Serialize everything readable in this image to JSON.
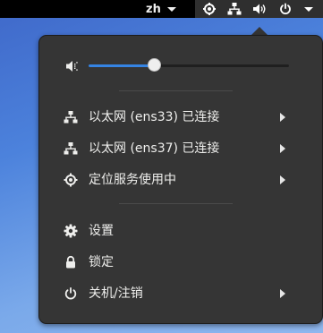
{
  "topbar": {
    "input_method": "zh",
    "icons": [
      "location-icon",
      "network-icon",
      "volume-icon",
      "power-icon"
    ]
  },
  "system_menu": {
    "volume": {
      "level": 0.33,
      "icon": "volume-low-icon"
    },
    "network_items": [
      {
        "label": "以太网 (ens33) 已连接",
        "icon": "wired-network-icon"
      },
      {
        "label": "以太网 (ens37) 已连接",
        "icon": "wired-network-icon"
      },
      {
        "label": "定位服务使用中",
        "icon": "location-icon"
      }
    ],
    "actions": [
      {
        "label": "设置",
        "icon": "gear-icon"
      },
      {
        "label": "锁定",
        "icon": "lock-icon"
      },
      {
        "label": "关机/注销",
        "icon": "power-icon"
      }
    ]
  },
  "colors": {
    "accent": "#3584e4",
    "menu_bg": "#353535",
    "topbar_bg": "#000000"
  }
}
